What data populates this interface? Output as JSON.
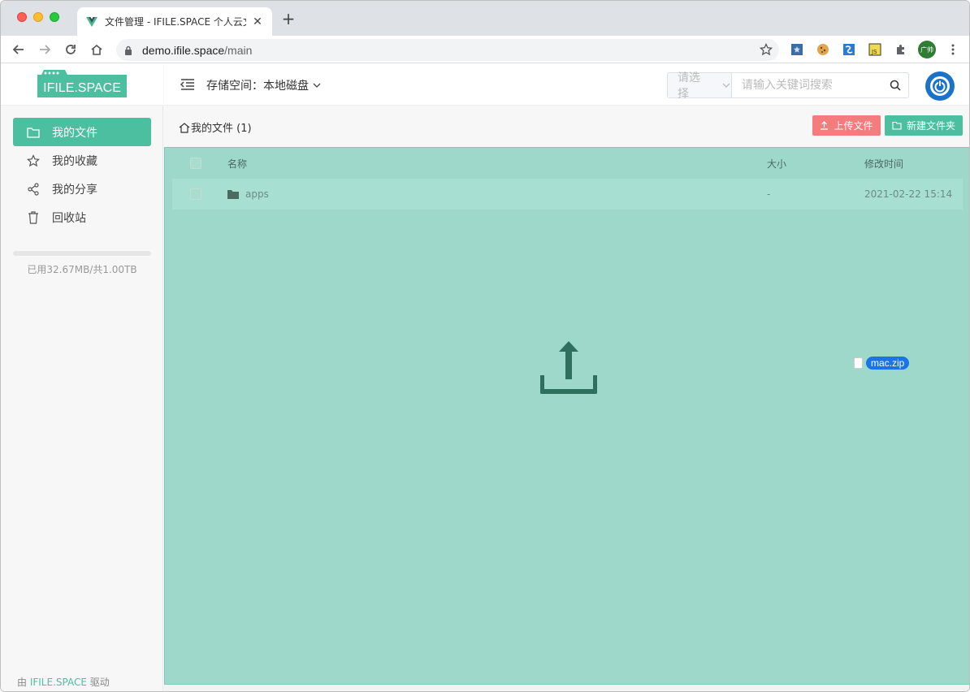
{
  "browser": {
    "tab_title": "文件管理 - IFILE.SPACE 个人云文",
    "url_host": "demo.ifile.space",
    "url_path": "/main",
    "profile_label": "广帅"
  },
  "app": {
    "logo_text": "IFILE.SPACE",
    "storage_label": "存储空间：",
    "storage_value": "本地磁盘",
    "search": {
      "select_placeholder": "请选择",
      "input_placeholder": "请输入关键词搜索"
    },
    "menu": [
      {
        "label": "我的文件",
        "icon": "folder-icon",
        "active": true
      },
      {
        "label": "我的收藏",
        "icon": "star-icon",
        "active": false
      },
      {
        "label": "我的分享",
        "icon": "share-icon",
        "active": false
      },
      {
        "label": "回收站",
        "icon": "trash-icon",
        "active": false
      }
    ],
    "storage_usage_text": "已用32.67MB/共1.00TB",
    "storage_usage_fraction": 0.0,
    "powered_prefix": "由 ",
    "powered_brand": "IFILE.SPACE",
    "powered_suffix": " 驱动",
    "breadcrumb": "我的文件 (1)",
    "upload_button": "上传文件",
    "new_folder_button": "新建文件夹",
    "table": {
      "headers": {
        "name": "名称",
        "size": "大小",
        "modified": "修改时间"
      },
      "rows": [
        {
          "name": "apps",
          "size": "-",
          "modified": "2021-02-22 15:14"
        }
      ]
    },
    "drag_file_name": "mac.zip",
    "colors": {
      "accent": "#4bbf9f",
      "danger": "#f47c7c",
      "dropzone": "#9dd8cb",
      "upload_icon": "#2f6f5e"
    }
  }
}
